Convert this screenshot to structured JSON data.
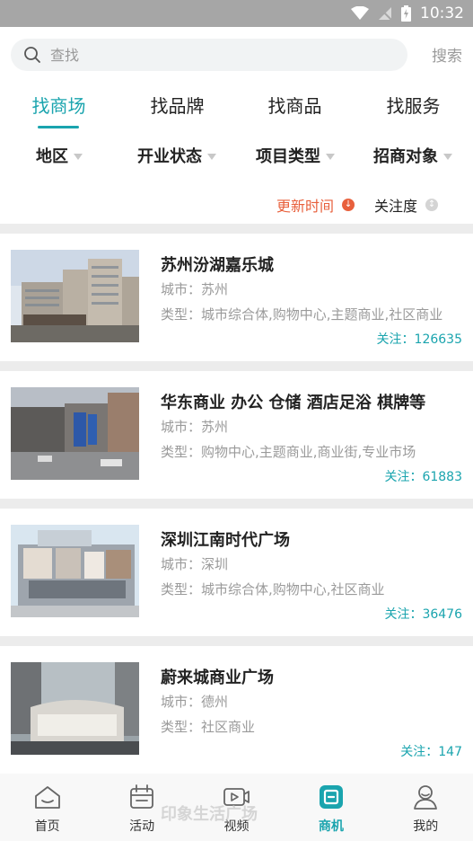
{
  "status_bar": {
    "time": "10:32"
  },
  "search": {
    "placeholder": "查找",
    "button_label": "搜索"
  },
  "tabs": [
    {
      "label": "找商场",
      "active": true
    },
    {
      "label": "找品牌",
      "active": false
    },
    {
      "label": "找商品",
      "active": false
    },
    {
      "label": "找服务",
      "active": false
    }
  ],
  "filters": [
    {
      "label": "地区"
    },
    {
      "label": "开业状态"
    },
    {
      "label": "项目类型"
    },
    {
      "label": "招商对象"
    }
  ],
  "sort": {
    "update_time": "更新时间",
    "attention": "关注度",
    "update_time_color": "#e8603c",
    "attention_color": "#c8c8c8"
  },
  "listings": [
    {
      "title": "苏州汾湖嘉乐城",
      "city": "城市：苏州",
      "type": "类型：城市综合体,购物中心,主题商业,社区商业",
      "follow": "关注：126635"
    },
    {
      "title": "华东商业 办公 仓储 酒店足浴 棋牌等",
      "city": "城市：苏州",
      "type": "类型：购物中心,主题商业,商业街,专业市场",
      "follow": "关注：61883"
    },
    {
      "title": "深圳江南时代广场",
      "city": "城市：深圳",
      "type": "类型：城市综合体,购物中心,社区商业",
      "follow": "关注：36476"
    },
    {
      "title": "蔚来城商业广场",
      "city": "城市：德州",
      "type": "类型：社区商业",
      "follow": "关注：147"
    }
  ],
  "partial_listing_title": "印象生活广场",
  "bottom_nav": [
    {
      "label": "首页",
      "icon": "home-icon",
      "active": false
    },
    {
      "label": "活动",
      "icon": "calendar-icon",
      "active": false
    },
    {
      "label": "视频",
      "icon": "video-icon",
      "active": false
    },
    {
      "label": "商机",
      "icon": "opportunity-icon",
      "active": true
    },
    {
      "label": "我的",
      "icon": "user-icon",
      "active": false
    }
  ],
  "colors": {
    "accent": "#1aa4ae",
    "sort_active": "#e8603c",
    "muted": "#9a9a9a"
  }
}
